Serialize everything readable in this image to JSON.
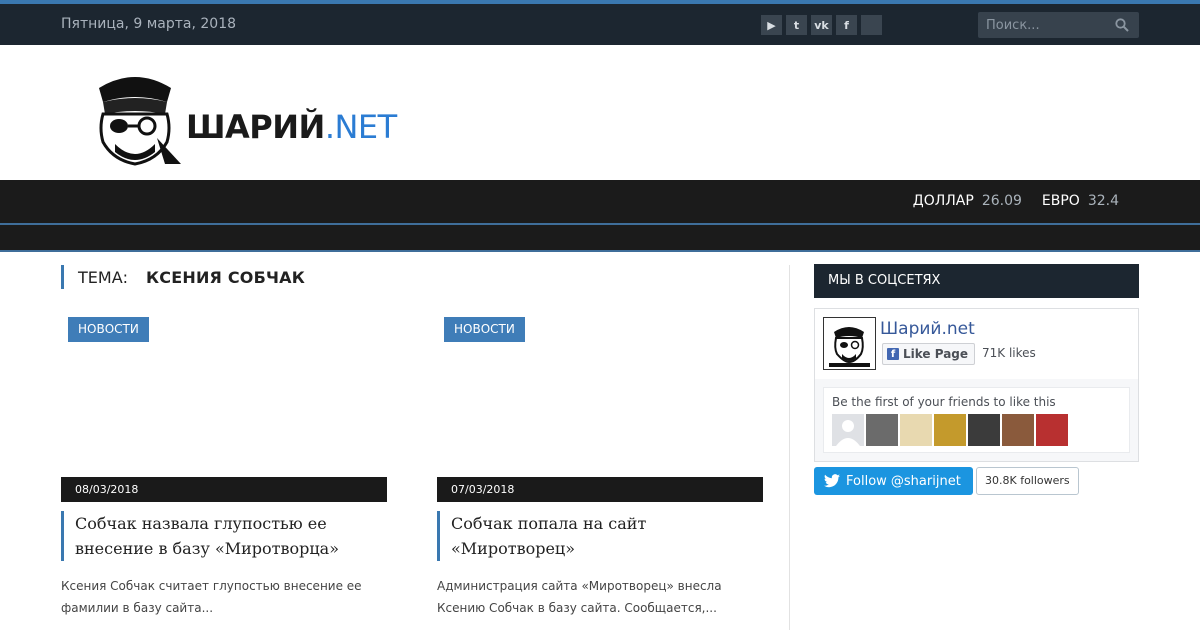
{
  "topbar": {
    "date": "Пятница, 9 марта, 2018",
    "social_icons": [
      "youtube-icon",
      "twitter-icon",
      "vk-icon",
      "facebook-icon",
      "rss-icon"
    ],
    "search_placeholder": "Поиск..."
  },
  "header": {
    "logo_text_main": "ШАРИЙ",
    "logo_text_suffix": ".NET"
  },
  "nav": {
    "rates": [
      {
        "label": "ДОЛЛАР",
        "value": "26.09"
      },
      {
        "label": "ЕВРО",
        "value": "32.4"
      }
    ]
  },
  "main": {
    "topic_label": "ТЕМА:",
    "topic_name": "КСЕНИЯ СОБЧАК",
    "posts": [
      {
        "category": "НОВОСТИ",
        "date": "08/03/2018",
        "title": "Собчак назвала глупостью ее внесение в базу «Миротворца»",
        "excerpt": "Ксения Собчак считает глупостью внесение ее фамилии в базу сайта..."
      },
      {
        "category": "НОВОСТИ",
        "date": "07/03/2018",
        "title": "Собчак попала на сайт «Миротворец»",
        "excerpt": "Администрация сайта «Миротворец» внесла Ксению Собчак в базу сайта. Сообщается,..."
      }
    ]
  },
  "sidebar": {
    "heading": "МЫ В СОЦСЕТЯХ",
    "fb": {
      "page_name": "Шарий.net",
      "like_label": "Like Page",
      "likes": "71K likes",
      "friends_text": "Be the first of your friends to like this",
      "avatar_colors": [
        "#c9ccd1",
        "#6b6b6b",
        "#e8d9b0",
        "#c49a2c",
        "#3b3b3b",
        "#8a5a3c",
        "#b83030"
      ]
    },
    "twitter": {
      "follow_label": "Follow @sharijnet",
      "followers": "30.8K followers"
    }
  },
  "colors": {
    "accent": "#3a78b0",
    "topbar_bg": "#1c2630",
    "nav_bg": "#1b1b1b",
    "badge_bg": "#3f7db8",
    "twitter": "#1b95e0"
  }
}
